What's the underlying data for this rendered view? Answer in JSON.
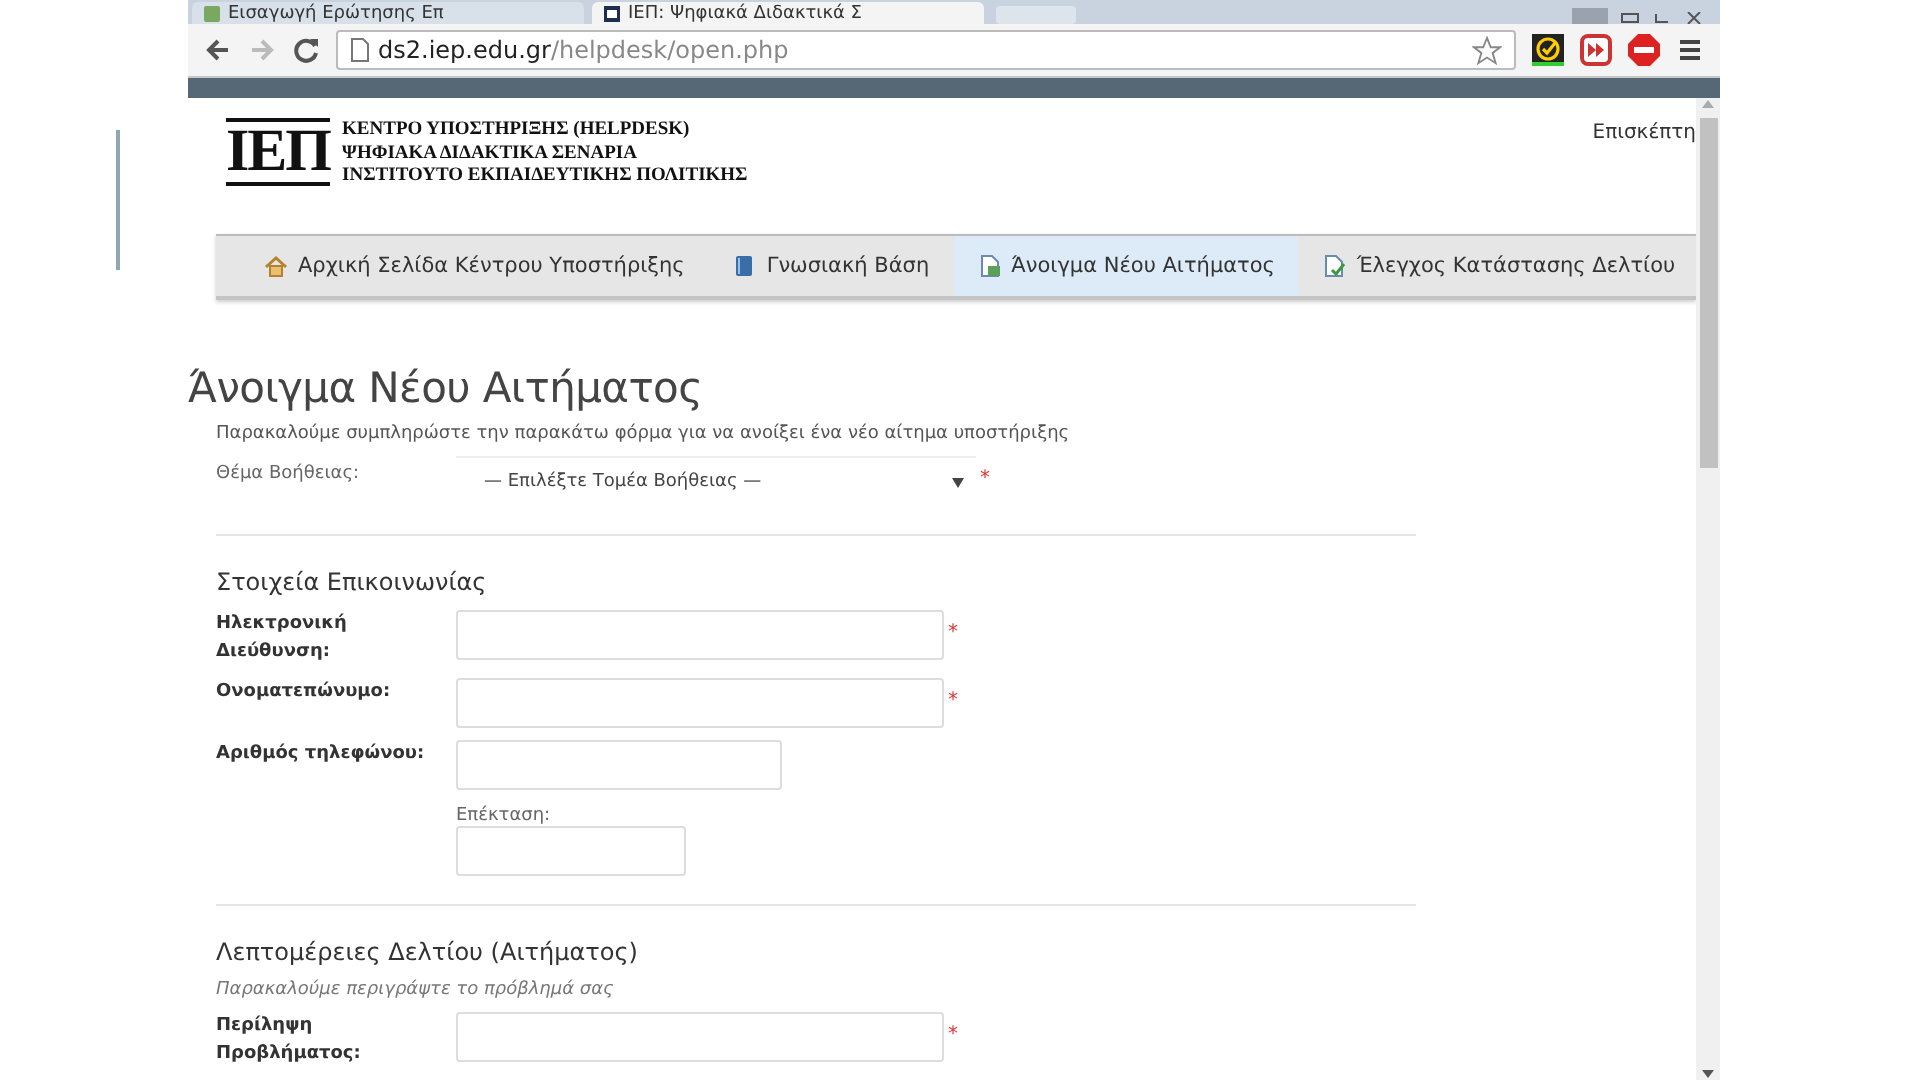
{
  "browser": {
    "tabs": [
      {
        "title": "Εισαγωγή Ερώτησης Επ",
        "selected": false
      },
      {
        "title": "ΙΕΠ: Ψηφιακά Διδακτικά Σ",
        "selected": true
      }
    ],
    "url_host": "ds2.iep.edu.gr",
    "url_path": "/helpdesk/open.php"
  },
  "header": {
    "logo": "ΙΕΠ",
    "lines": [
      "ΚΕΝΤΡΟ ΥΠΟΣΤΗΡΙΞΗΣ (HELPDESK)",
      "ΨΗΦΙΑΚΑ ΔΙΔΑΚΤΙΚΑ ΣΕΝΑΡΙΑ",
      "ΙΝΣΤΙΤΟΥΤΟ ΕΚΠΑΙΔΕΥΤΙΚΗΣ ΠΟΛΙΤΙΚΗΣ"
    ],
    "user": "Επισκέπτη"
  },
  "nav": [
    {
      "label": "Αρχική Σελίδα Κέντρου Υποστήριξης",
      "kind": "home",
      "selected": false
    },
    {
      "label": "Γνωσιακή Βάση",
      "kind": "book",
      "selected": false
    },
    {
      "label": "Άνοιγμα Νέου Αιτήματος",
      "kind": "doc",
      "selected": true
    },
    {
      "label": "Έλεγχος Κατάστασης Δελτίου",
      "kind": "check",
      "selected": false
    }
  ],
  "form": {
    "title": "Άνοιγμα Νέου Αιτήματος",
    "intro": "Παρακαλούμε συμπληρώστε την παρακάτω φόρμα για να ανοίξει ένα νέο αίτημα υποστήριξης",
    "topic": {
      "label": "Θέμα Βοήθειας:",
      "value": "— Επιλέξτε Τομέα Βοήθειας —",
      "marker": "*"
    },
    "sections": [
      {
        "heading": "Στοιχεία Επικοινωνίας",
        "fields": [
          {
            "label": "Ηλεκτρονική Διεύθυνση:",
            "marker": "*"
          },
          {
            "label": "Ονοματεπώνυμο:",
            "marker": "*"
          },
          {
            "label": "Αριθμός τηλεφώνου:",
            "extension_label": "Επέκταση:"
          }
        ]
      },
      {
        "heading": "Λεπτομέρειες Δελτίου (Αιτήματος)",
        "hint": "Παρακαλούμε περιγράψτε το πρόβλημά σας",
        "fields": [
          {
            "label": "Περίληψη Προβλήματος:",
            "marker": "*"
          }
        ]
      }
    ]
  }
}
